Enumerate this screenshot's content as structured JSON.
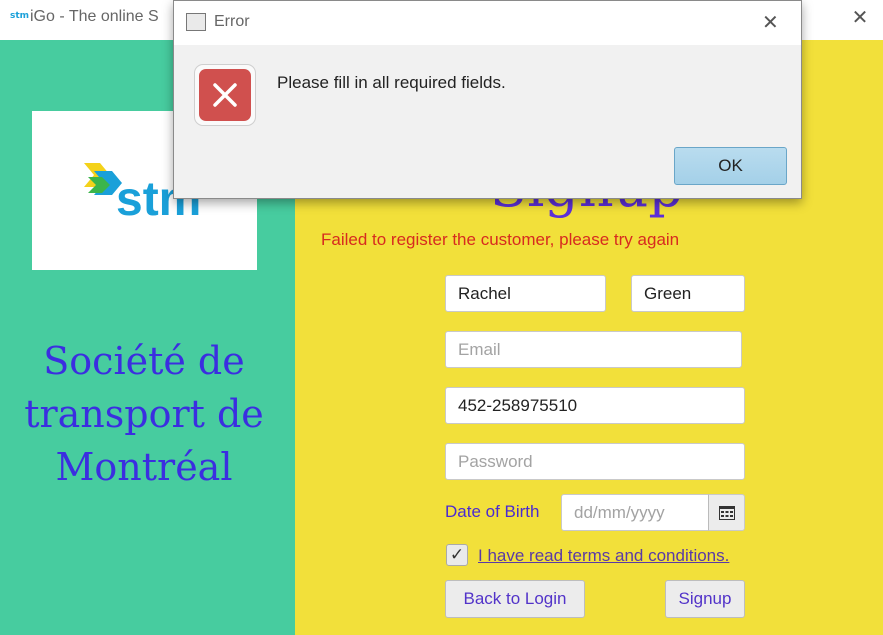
{
  "window": {
    "title": "iGo - The online S",
    "app_icon_text": "stm",
    "close_glyph": "✕"
  },
  "left_panel": {
    "logo_text": "stm",
    "org_name": "Société de transport de Montréal",
    "colors": {
      "background": "#47cc9f",
      "org_text": "#3b2ee0"
    }
  },
  "signup": {
    "title": "Signup",
    "error_message": "Failed to register the customer, please try again",
    "first_name": "Rachel",
    "last_name": "Green",
    "email_placeholder": "Email",
    "phone": "452-258975510",
    "password_placeholder": "Password",
    "dob_label": "Date of Birth",
    "dob_placeholder": "dd/mm/yyyy",
    "calendar_icon": "calendar-icon",
    "terms_checked": "✓",
    "terms_label": "I have read terms and conditions.",
    "back_button": "Back to Login",
    "signup_button": "Signup",
    "colors": {
      "background": "#f2e03a",
      "error": "#d72b1f",
      "title": "#5c2fd8"
    }
  },
  "dialog": {
    "title": "Error",
    "message": "Please fill in all required fields.",
    "ok_label": "OK",
    "close_glyph": "✕",
    "icon": "error-x-icon",
    "colors": {
      "icon_bg": "#d0504e"
    }
  }
}
